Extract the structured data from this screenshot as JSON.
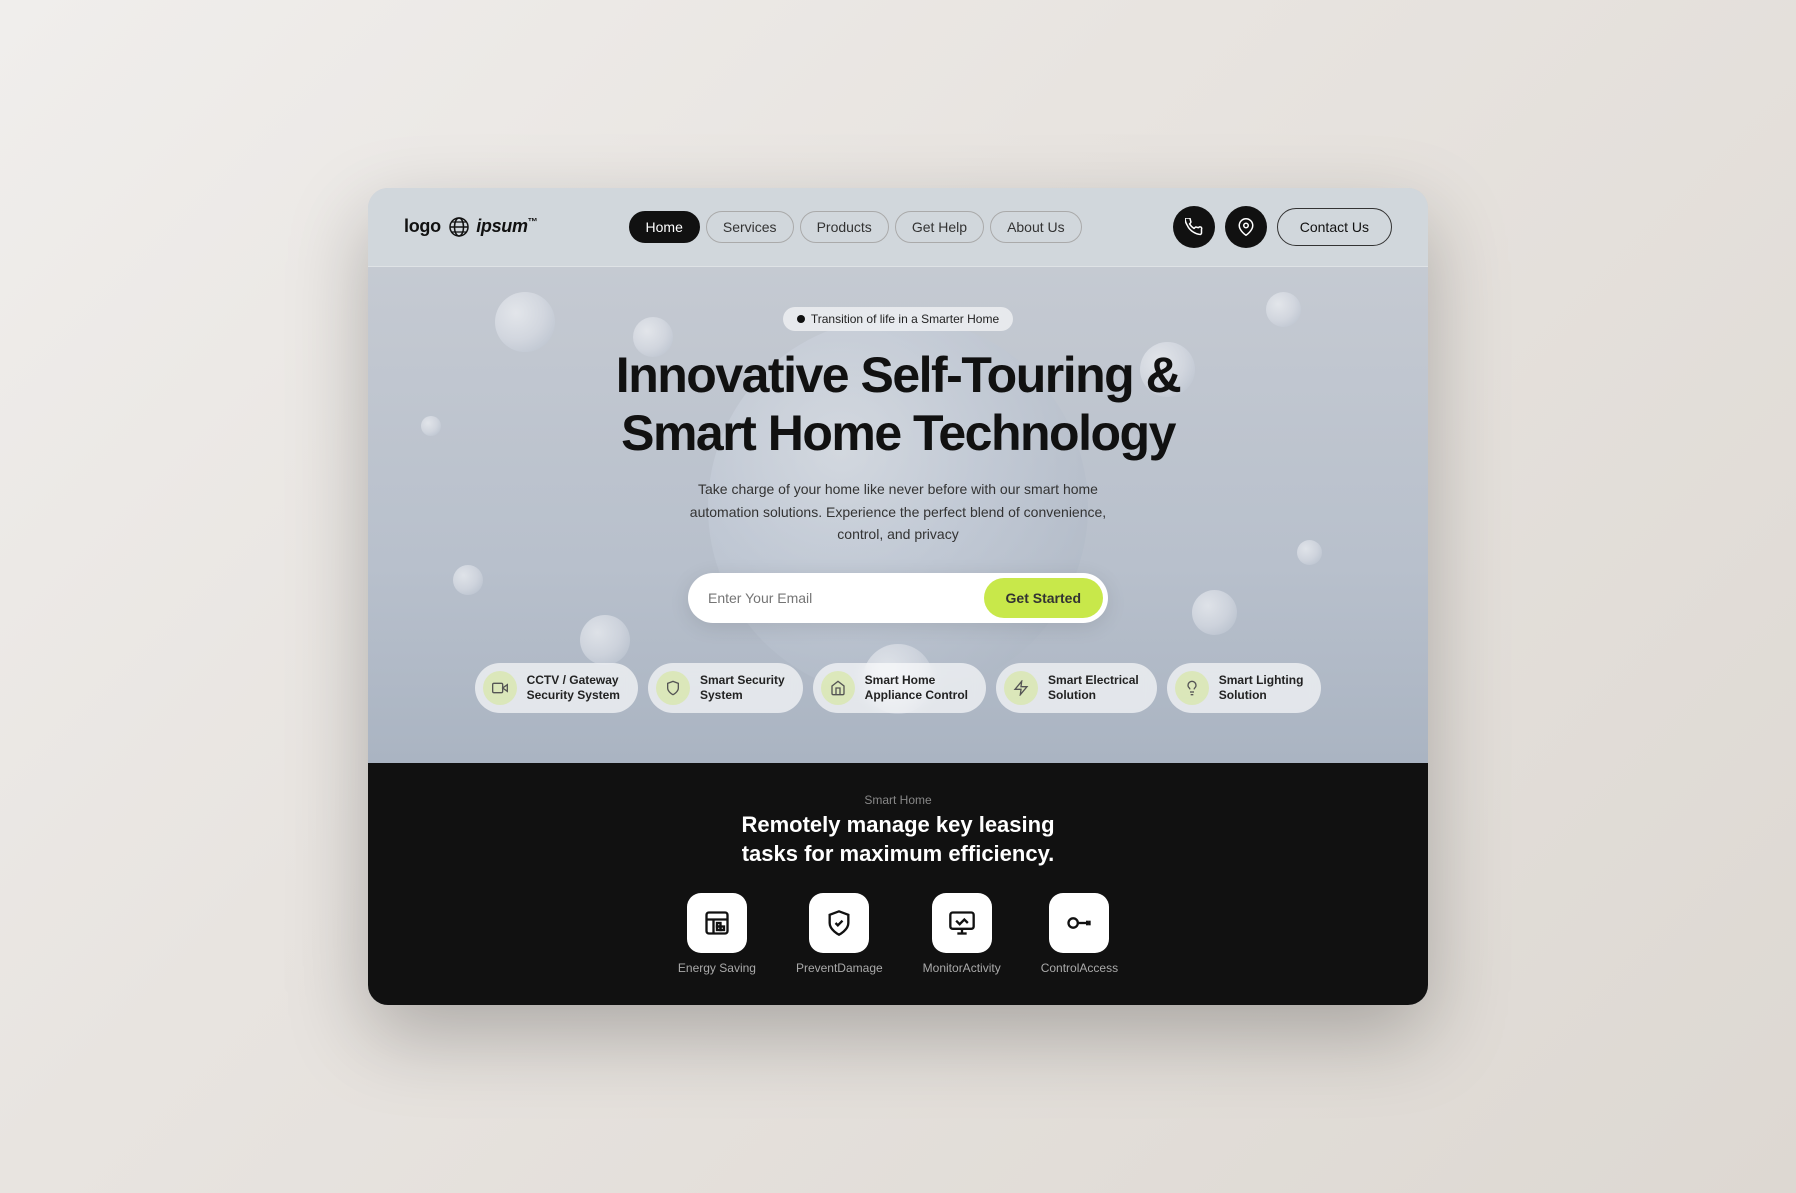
{
  "logo": {
    "text": "logo",
    "brand": "ipsum",
    "trademark": "™"
  },
  "nav": {
    "items": [
      {
        "id": "home",
        "label": "Home",
        "active": true
      },
      {
        "id": "services",
        "label": "Services",
        "active": false
      },
      {
        "id": "products",
        "label": "Products",
        "active": false
      },
      {
        "id": "get-help",
        "label": "Get Help",
        "active": false
      },
      {
        "id": "about-us",
        "label": "About Us",
        "active": false
      }
    ],
    "contact_button": "Contact Us"
  },
  "hero": {
    "badge": "Transition of life in a Smarter Home",
    "title_line1": "Innovative Self-Touring &",
    "title_line2": "Smart Home Technology",
    "subtitle": "Take charge of your home like never before with our smart home automation solutions. Experience the perfect blend of convenience, control, and privacy",
    "email_placeholder": "Enter Your Email",
    "cta_button": "Get Started"
  },
  "feature_pills": [
    {
      "id": "cctv",
      "icon": "📷",
      "label_line1": "CCTV / Gateway",
      "label_line2": "Security System"
    },
    {
      "id": "security",
      "icon": "🔒",
      "label_line1": "Smart Security",
      "label_line2": "System"
    },
    {
      "id": "appliance",
      "icon": "🏠",
      "label_line1": "Smart Home",
      "label_line2": "Appliance Control"
    },
    {
      "id": "electrical",
      "icon": "⚡",
      "label_line1": "Smart Electrical",
      "label_line2": "Solution"
    },
    {
      "id": "lighting",
      "icon": "💡",
      "label_line1": "Smart Lighting",
      "label_line2": "Solution"
    }
  ],
  "bottom": {
    "label": "Smart Home",
    "title_line1": "Remotely manage key leasing",
    "title_line2": "tasks for maximum efficiency.",
    "features": [
      {
        "id": "energy",
        "icon": "📊",
        "label": "Energy Saving"
      },
      {
        "id": "damage",
        "icon": "🛡",
        "label": "PreventDamage"
      },
      {
        "id": "monitor",
        "icon": "📺",
        "label": "MonitorActivity"
      },
      {
        "id": "access",
        "icon": "🔑",
        "label": "ControlAccess"
      }
    ]
  },
  "colors": {
    "accent": "#c8e84a",
    "dark": "#111111",
    "nav_bg": "#d2d7de"
  }
}
